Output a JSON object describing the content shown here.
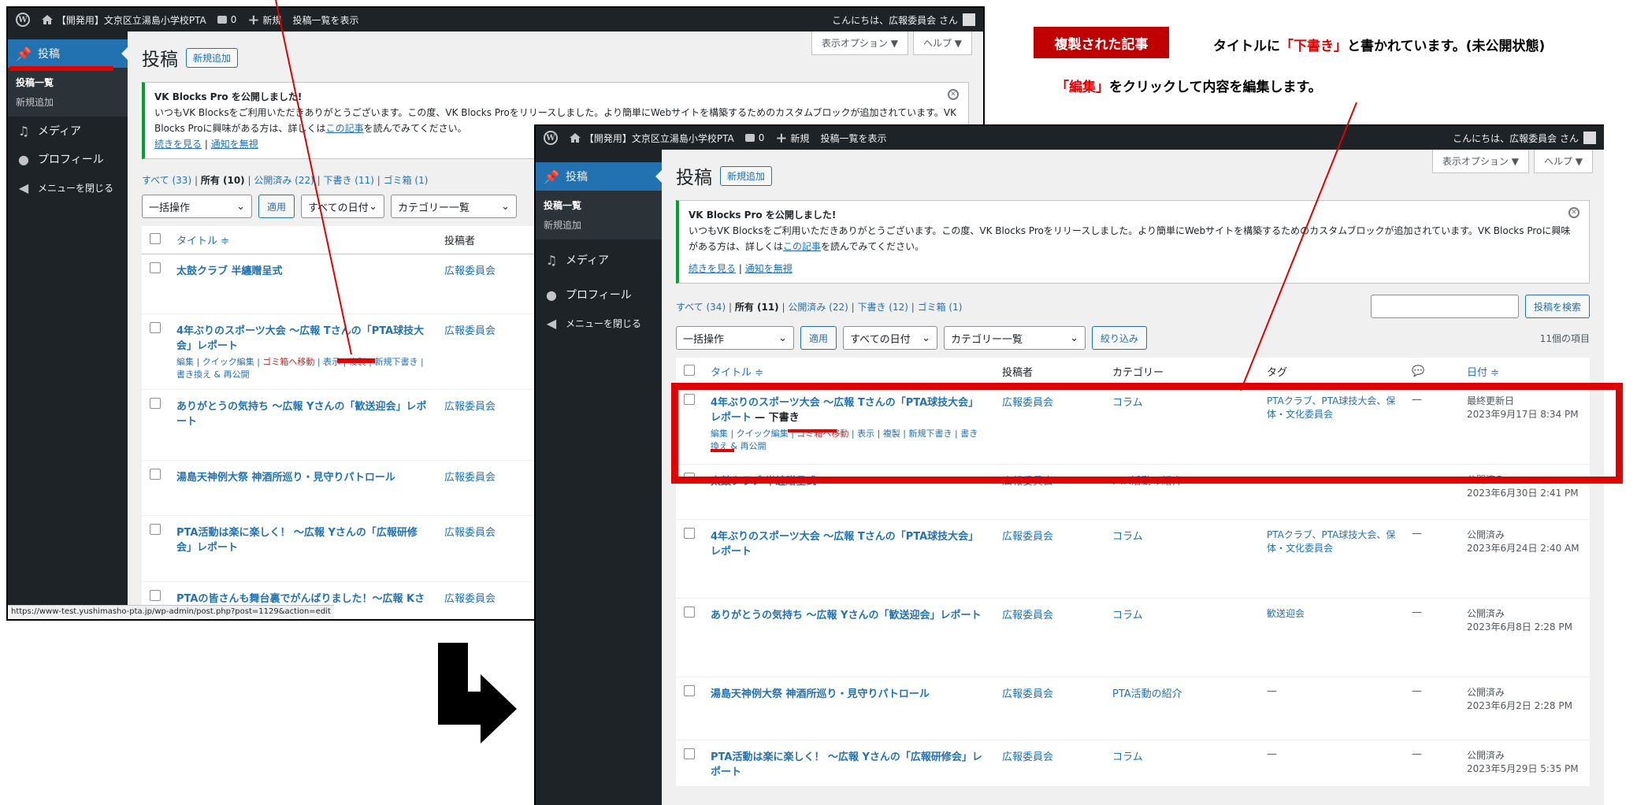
{
  "annotation": {
    "badge": "複製された記事",
    "line1_pre": "タイトルに",
    "line1_red": "「下書き」",
    "line1_post": "と書かれています。(未公開状態)",
    "line2_red": "「編集」",
    "line2_post": "をクリックして内容を編集します。"
  },
  "adminbar": {
    "site": "【開発用】文京区立湯島小学校PTA",
    "comments": "0",
    "new": "新規",
    "view": "投稿一覧を表示",
    "greeting": "こんにちは、広報委員会 さん"
  },
  "sidebar": {
    "posts": "投稿",
    "all_posts": "投稿一覧",
    "add_new": "新規追加",
    "media": "メディア",
    "profile": "プロフィール",
    "collapse": "メニューを閉じる"
  },
  "screen": {
    "options": "表示オプション ▼",
    "help": "ヘルプ ▼",
    "title": "投稿",
    "add_new": "新規追加"
  },
  "notice": {
    "title": "VK Blocks Pro を公開しました!",
    "body": "いつもVK Blocksをご利用いただきありがとうございます。この度、VK Blocks Proをリリースしました。より簡単にWebサイトを構築するためのカスタムブロックが追加されています。VK Blocks Proに興味がある方は、詳しくは",
    "link": "この記事",
    "body2": "を読んでみてください。",
    "more": "続きを見る",
    "ignore": "通知を無視"
  },
  "shotA": {
    "filters": {
      "all": "すべて (33)",
      "mine": "所有 (10)",
      "published": "公開済み (22)",
      "drafts": "下書き (11)",
      "trash": "ゴミ箱 (1)"
    },
    "bulk": "一括操作",
    "apply": "適用",
    "dates": "すべての日付",
    "cats": "カテゴリー一覧",
    "col_title": "タイトル ≑",
    "col_author": "投稿者",
    "rows": [
      {
        "title": "太鼓クラブ 半纏贈呈式",
        "author": "広報委員会"
      },
      {
        "title": "4年ぶりのスポーツ大会 ～広報 Tさんの「PTA球技大会」レポート",
        "author": "広報委員会",
        "actions": true
      },
      {
        "title": "ありがとうの気持ち ～広報 Yさんの「歓送迎会」レポート",
        "author": "広報委員会"
      },
      {
        "title": "湯島天神例大祭 神酒所巡り・見守りパトロール",
        "author": "広報委員会"
      },
      {
        "title": "PTA活動は楽に楽しく！ ～広報 Yさんの「広報研修会」レポート",
        "author": "広報委員会"
      },
      {
        "title": "PTAの皆さんも舞台裏でがんばりました！～広報 Kさんの「運動会」レポート",
        "author": "広報委員会"
      }
    ],
    "statusbar": "https://www-test.yushimasho-pta.jp/wp-admin/post.php?post=1129&action=edit"
  },
  "row_actions": {
    "edit": "編集",
    "quick": "クイック編集",
    "trash": "ゴミ箱へ移動",
    "view": "表示",
    "copy": "複製",
    "new_draft": "新規下書き",
    "rewrite": "書き換え & 再公開"
  },
  "shotB": {
    "filters": {
      "all": "すべて (34)",
      "mine": "所有 (11)",
      "published": "公開済み (22)",
      "drafts": "下書き (12)",
      "trash": "ゴミ箱 (1)"
    },
    "bulk": "一括操作",
    "apply": "適用",
    "dates": "すべての日付",
    "cats": "カテゴリー一覧",
    "filter": "絞り込み",
    "search_btn": "投稿を検索",
    "count": "11個の項目",
    "cols": {
      "title": "タイトル ≑",
      "author": "投稿者",
      "category": "カテゴリー",
      "tags": "タグ",
      "date": "日付 ≑"
    },
    "draft_label": "— 下書き",
    "rows": [
      {
        "title": "4年ぶりのスポーツ大会 ～広報 Tさんの「PTA球技大会」レポート",
        "author": "広報委員会",
        "category": "コラム",
        "tags": "PTAクラブ、PTA球技大会、保体・文化委員会",
        "comments": "—",
        "status": "最終更新日",
        "date": "2023年9月17日 8:34 PM",
        "draft": true
      },
      {
        "title": "太鼓クラブ 半纏贈呈式",
        "author": "広報委員会",
        "category": "PTA活動の紹介",
        "tags": "—",
        "comments": "—",
        "status": "公開済み",
        "date": "2023年6月30日 2:41 PM"
      },
      {
        "title": "4年ぶりのスポーツ大会 ～広報 Tさんの「PTA球技大会」レポート",
        "author": "広報委員会",
        "category": "コラム",
        "tags": "PTAクラブ、PTA球技大会、保体・文化委員会",
        "comments": "—",
        "status": "公開済み",
        "date": "2023年6月24日 2:40 AM"
      },
      {
        "title": "ありがとうの気持ち ～広報 Yさんの「歓送迎会」レポート",
        "author": "広報委員会",
        "category": "コラム",
        "tags": "歓送迎会",
        "comments": "—",
        "status": "公開済み",
        "date": "2023年6月8日 2:28 PM"
      },
      {
        "title": "湯島天神例大祭 神酒所巡り・見守りパトロール",
        "author": "広報委員会",
        "category": "PTA活動の紹介",
        "tags": "—",
        "comments": "—",
        "status": "公開済み",
        "date": "2023年6月2日 2:28 PM"
      },
      {
        "title": "PTA活動は楽に楽しく！ ～広報 Yさんの「広報研修会」レポート",
        "author": "広報委員会",
        "category": "コラム",
        "tags": "—",
        "comments": "—",
        "status": "公開済み",
        "date": "2023年5月29日 5:35 PM"
      }
    ]
  }
}
